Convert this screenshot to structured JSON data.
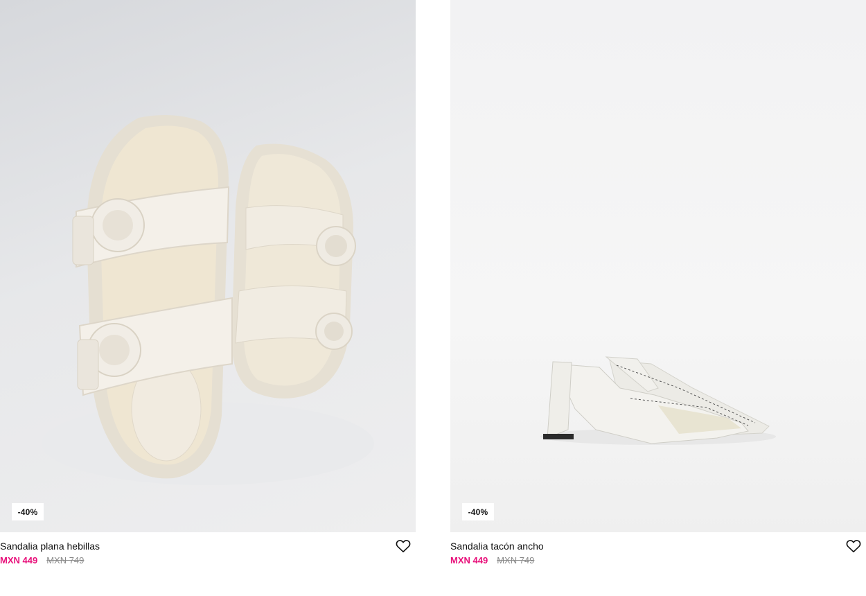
{
  "products": [
    {
      "name": "Sandalia plana hebillas",
      "discount_badge": "-40%",
      "price_current": "MXN 449",
      "price_original": "MXN 749",
      "favorite_icon": "heart-outline-icon"
    },
    {
      "name": "Sandalia tacón ancho",
      "discount_badge": "-40%",
      "price_current": "MXN 449",
      "price_original": "MXN 749",
      "favorite_icon": "heart-outline-icon"
    }
  ],
  "colors": {
    "sale_price": "#e8107a",
    "original_price": "#8a8a8a"
  }
}
